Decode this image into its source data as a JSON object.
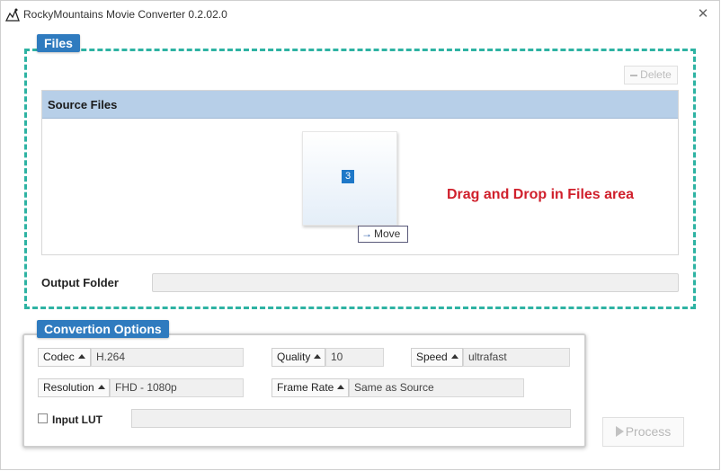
{
  "window": {
    "title": "RockyMountains Movie Converter 0.2.02.0",
    "close_glyph": "✕"
  },
  "files": {
    "group_label": "Files",
    "delete_label": "Delete",
    "source_header": "Source Files",
    "file_count": "3",
    "move_tip": "Move",
    "hint": "Drag and Drop in Files area",
    "output_label": "Output Folder",
    "output_value": ""
  },
  "options": {
    "group_label": "Convertion Options",
    "codec": {
      "label": "Codec",
      "value": "H.264"
    },
    "quality": {
      "label": "Quality",
      "value": "10"
    },
    "speed": {
      "label": "Speed",
      "value": "ultrafast"
    },
    "resolution": {
      "label": "Resolution",
      "value": "FHD - 1080p"
    },
    "frame_rate": {
      "label": "Frame Rate",
      "value": "Same as Source"
    },
    "input_lut": {
      "label": "Input LUT",
      "checked": false,
      "value": ""
    }
  },
  "process_label": "Process",
  "colors": {
    "accent": "#2f7bbf",
    "dashed_border": "#2eb3a3",
    "hint_text": "#d0202c",
    "header_bg": "#b7cfe8"
  },
  "icons": {
    "app": "app-logo-icon",
    "close": "close-icon",
    "delete": "minus-icon",
    "move": "arrow-right-icon",
    "process": "play-icon",
    "dropdown": "triangle-up-icon"
  }
}
